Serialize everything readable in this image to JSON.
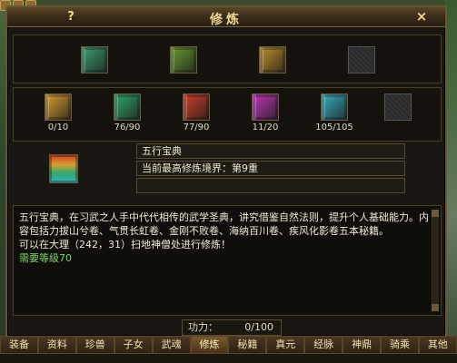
{
  "window": {
    "title": "修炼",
    "help_label": "?",
    "close_label": "×"
  },
  "top_row_items": [
    {
      "name": "book-teal-icon",
      "color": "#3aa070"
    },
    {
      "name": "book-green-icon",
      "color": "#6a9a30"
    },
    {
      "name": "book-gold-icon",
      "color": "#c0902a"
    },
    {
      "name": "empty-slot"
    }
  ],
  "scroll_items": [
    {
      "count": "0/10",
      "color": "#d8a030"
    },
    {
      "count": "76/90",
      "color": "#30a868"
    },
    {
      "count": "77/90",
      "color": "#d04028"
    },
    {
      "count": "11/20",
      "color": "#c038b8"
    },
    {
      "count": "105/105",
      "color": "#38b0c0"
    },
    {
      "count": ""
    }
  ],
  "selected": {
    "name": "五行宝典",
    "realm": "当前最高修炼境界：第9重",
    "extra": ""
  },
  "description": {
    "line1": "五行宝典，在习武之人手中代代相传的武学圣典，讲究借鉴自然法则，提升个人基础能力。内容包括力拔山兮卷、气贯长虹卷、金刚不败卷、海纳百川卷、疾风化影卷五本秘籍。",
    "line2": "可以在大理（242，31）扫地神僧处进行修炼！",
    "requirement": "需要等级70"
  },
  "power": {
    "label": "功力：",
    "value": "0/100"
  },
  "tabs": [
    {
      "label": "装备"
    },
    {
      "label": "资料"
    },
    {
      "label": "珍兽"
    },
    {
      "label": "子女"
    },
    {
      "label": "武魂"
    },
    {
      "label": "修炼",
      "active": true
    },
    {
      "label": "秘籍"
    },
    {
      "label": "真元"
    },
    {
      "label": "经脉"
    },
    {
      "label": "神鼎"
    },
    {
      "label": "骑乘"
    },
    {
      "label": "其他"
    }
  ]
}
